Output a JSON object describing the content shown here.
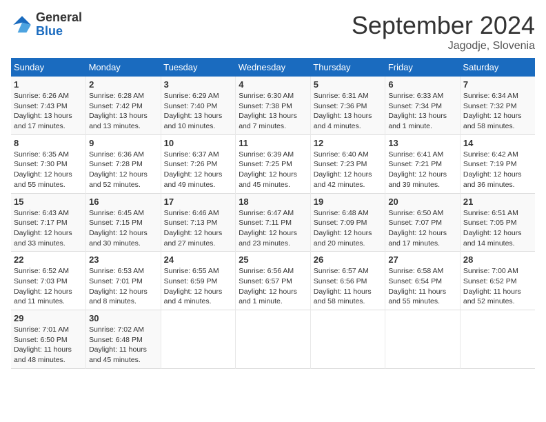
{
  "logo": {
    "general": "General",
    "blue": "Blue"
  },
  "title": "September 2024",
  "subtitle": "Jagodje, Slovenia",
  "headers": [
    "Sunday",
    "Monday",
    "Tuesday",
    "Wednesday",
    "Thursday",
    "Friday",
    "Saturday"
  ],
  "weeks": [
    [
      {
        "day": "1",
        "detail": "Sunrise: 6:26 AM\nSunset: 7:43 PM\nDaylight: 13 hours\nand 17 minutes."
      },
      {
        "day": "2",
        "detail": "Sunrise: 6:28 AM\nSunset: 7:42 PM\nDaylight: 13 hours\nand 13 minutes."
      },
      {
        "day": "3",
        "detail": "Sunrise: 6:29 AM\nSunset: 7:40 PM\nDaylight: 13 hours\nand 10 minutes."
      },
      {
        "day": "4",
        "detail": "Sunrise: 6:30 AM\nSunset: 7:38 PM\nDaylight: 13 hours\nand 7 minutes."
      },
      {
        "day": "5",
        "detail": "Sunrise: 6:31 AM\nSunset: 7:36 PM\nDaylight: 13 hours\nand 4 minutes."
      },
      {
        "day": "6",
        "detail": "Sunrise: 6:33 AM\nSunset: 7:34 PM\nDaylight: 13 hours\nand 1 minute."
      },
      {
        "day": "7",
        "detail": "Sunrise: 6:34 AM\nSunset: 7:32 PM\nDaylight: 12 hours\nand 58 minutes."
      }
    ],
    [
      {
        "day": "8",
        "detail": "Sunrise: 6:35 AM\nSunset: 7:30 PM\nDaylight: 12 hours\nand 55 minutes."
      },
      {
        "day": "9",
        "detail": "Sunrise: 6:36 AM\nSunset: 7:28 PM\nDaylight: 12 hours\nand 52 minutes."
      },
      {
        "day": "10",
        "detail": "Sunrise: 6:37 AM\nSunset: 7:26 PM\nDaylight: 12 hours\nand 49 minutes."
      },
      {
        "day": "11",
        "detail": "Sunrise: 6:39 AM\nSunset: 7:25 PM\nDaylight: 12 hours\nand 45 minutes."
      },
      {
        "day": "12",
        "detail": "Sunrise: 6:40 AM\nSunset: 7:23 PM\nDaylight: 12 hours\nand 42 minutes."
      },
      {
        "day": "13",
        "detail": "Sunrise: 6:41 AM\nSunset: 7:21 PM\nDaylight: 12 hours\nand 39 minutes."
      },
      {
        "day": "14",
        "detail": "Sunrise: 6:42 AM\nSunset: 7:19 PM\nDaylight: 12 hours\nand 36 minutes."
      }
    ],
    [
      {
        "day": "15",
        "detail": "Sunrise: 6:43 AM\nSunset: 7:17 PM\nDaylight: 12 hours\nand 33 minutes."
      },
      {
        "day": "16",
        "detail": "Sunrise: 6:45 AM\nSunset: 7:15 PM\nDaylight: 12 hours\nand 30 minutes."
      },
      {
        "day": "17",
        "detail": "Sunrise: 6:46 AM\nSunset: 7:13 PM\nDaylight: 12 hours\nand 27 minutes."
      },
      {
        "day": "18",
        "detail": "Sunrise: 6:47 AM\nSunset: 7:11 PM\nDaylight: 12 hours\nand 23 minutes."
      },
      {
        "day": "19",
        "detail": "Sunrise: 6:48 AM\nSunset: 7:09 PM\nDaylight: 12 hours\nand 20 minutes."
      },
      {
        "day": "20",
        "detail": "Sunrise: 6:50 AM\nSunset: 7:07 PM\nDaylight: 12 hours\nand 17 minutes."
      },
      {
        "day": "21",
        "detail": "Sunrise: 6:51 AM\nSunset: 7:05 PM\nDaylight: 12 hours\nand 14 minutes."
      }
    ],
    [
      {
        "day": "22",
        "detail": "Sunrise: 6:52 AM\nSunset: 7:03 PM\nDaylight: 12 hours\nand 11 minutes."
      },
      {
        "day": "23",
        "detail": "Sunrise: 6:53 AM\nSunset: 7:01 PM\nDaylight: 12 hours\nand 8 minutes."
      },
      {
        "day": "24",
        "detail": "Sunrise: 6:55 AM\nSunset: 6:59 PM\nDaylight: 12 hours\nand 4 minutes."
      },
      {
        "day": "25",
        "detail": "Sunrise: 6:56 AM\nSunset: 6:57 PM\nDaylight: 12 hours\nand 1 minute."
      },
      {
        "day": "26",
        "detail": "Sunrise: 6:57 AM\nSunset: 6:56 PM\nDaylight: 11 hours\nand 58 minutes."
      },
      {
        "day": "27",
        "detail": "Sunrise: 6:58 AM\nSunset: 6:54 PM\nDaylight: 11 hours\nand 55 minutes."
      },
      {
        "day": "28",
        "detail": "Sunrise: 7:00 AM\nSunset: 6:52 PM\nDaylight: 11 hours\nand 52 minutes."
      }
    ],
    [
      {
        "day": "29",
        "detail": "Sunrise: 7:01 AM\nSunset: 6:50 PM\nDaylight: 11 hours\nand 48 minutes."
      },
      {
        "day": "30",
        "detail": "Sunrise: 7:02 AM\nSunset: 6:48 PM\nDaylight: 11 hours\nand 45 minutes."
      },
      null,
      null,
      null,
      null,
      null
    ]
  ]
}
